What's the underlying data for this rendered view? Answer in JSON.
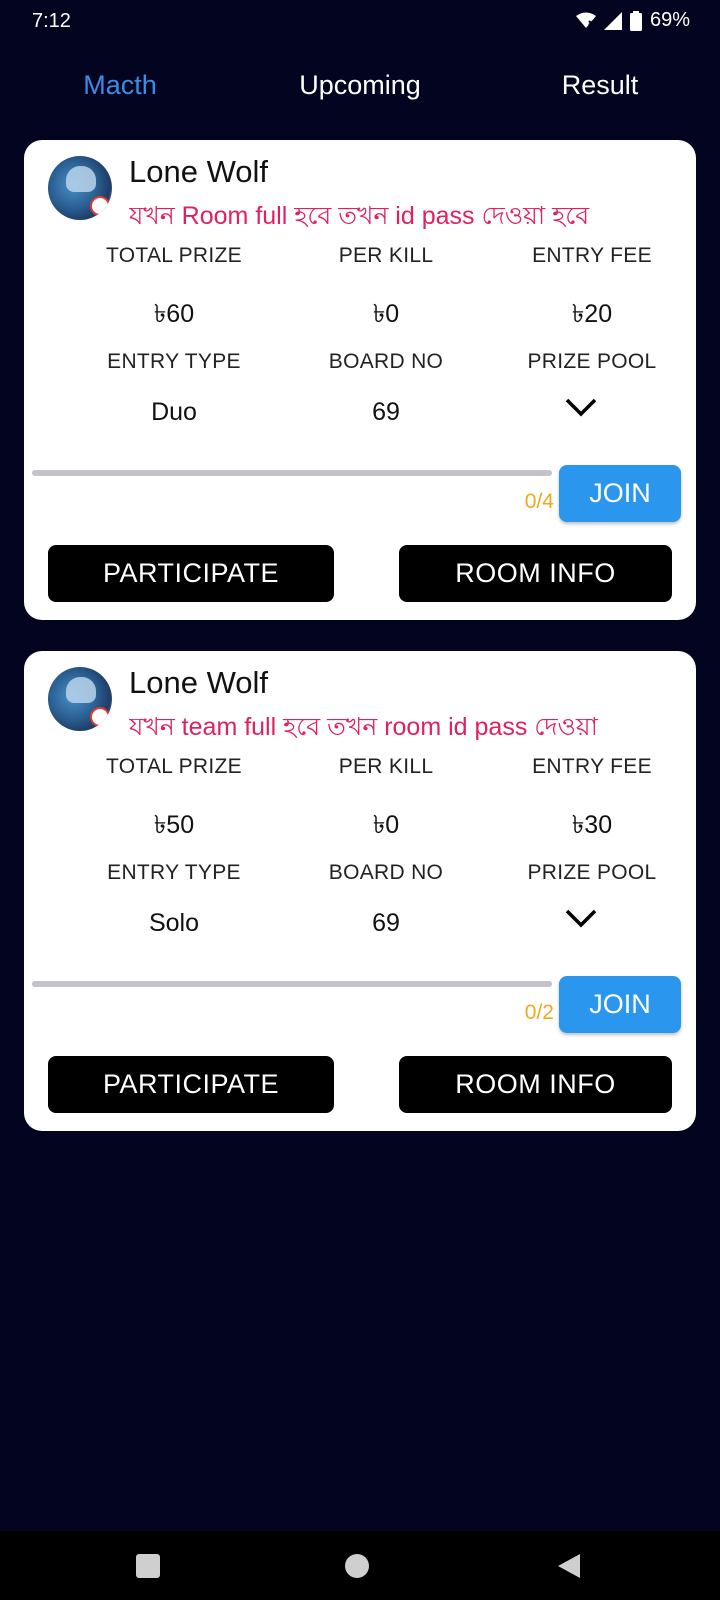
{
  "status_bar": {
    "time": "7:12",
    "battery": "69%"
  },
  "tabs": [
    {
      "label": "Macth",
      "active": true
    },
    {
      "label": "Upcoming",
      "active": false
    },
    {
      "label": "Result",
      "active": false
    }
  ],
  "colors": {
    "background": "#03041f",
    "accent": "#3a8ce6",
    "notice": "#e0215f",
    "join": "#2b96ee",
    "count": "#f2a81d"
  },
  "labels": {
    "total_prize": "TOTAL PRIZE",
    "per_kill": "PER KILL",
    "entry_fee": "ENTRY FEE",
    "entry_type": "ENTRY TYPE",
    "board_no": "BOARD NO",
    "prize_pool": "PRIZE POOL",
    "join": "JOIN",
    "participate": "PARTICIPATE",
    "room_info": "ROOM INFO"
  },
  "matches": [
    {
      "title": "Lone Wolf",
      "notice": "যখন Room full হবে তখন id pass দেওয়া হবে",
      "total_prize": "৳60",
      "per_kill": "৳0",
      "entry_fee": "৳20",
      "entry_type": "Duo",
      "board_no": "69",
      "progress_fraction": 0,
      "count": "0/4"
    },
    {
      "title": "Lone Wolf",
      "notice": "যখন team full হবে তখন room id pass দেওয়া",
      "total_prize": "৳50",
      "per_kill": "৳0",
      "entry_fee": "৳30",
      "entry_type": "Solo",
      "board_no": "69",
      "progress_fraction": 0,
      "count": "0/2"
    }
  ],
  "icons": {
    "status": [
      "wifi-icon",
      "signal-icon",
      "battery-icon"
    ],
    "card": [
      "avatar",
      "chevron-down-icon"
    ],
    "nav": [
      "recents-icon",
      "home-icon",
      "back-icon"
    ]
  }
}
